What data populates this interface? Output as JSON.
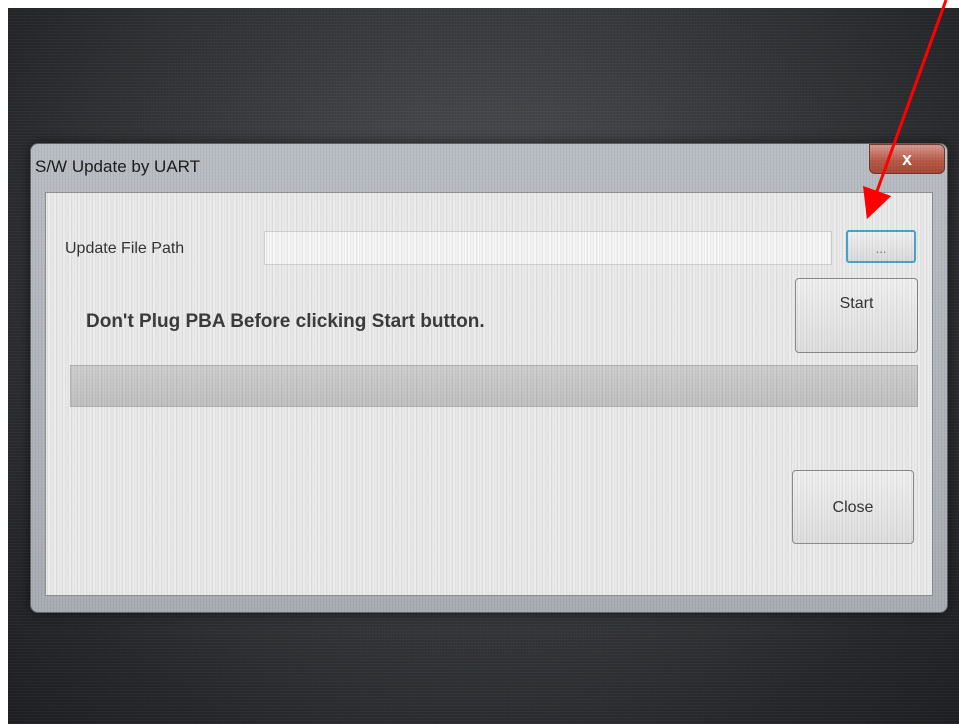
{
  "window": {
    "title": "S/W Update by UART",
    "close_glyph": "x"
  },
  "update_file_path": {
    "label": "Update File Path",
    "value": "",
    "browse_label": "..."
  },
  "warning": "Don't Plug PBA Before clicking Start button.",
  "buttons": {
    "start": "Start",
    "close": "Close"
  },
  "progress": {
    "fraction": 0
  },
  "colors": {
    "annotation_arrow": "#ff0000",
    "focus_border": "#4aa3c9",
    "close_button_red": "#b85a48"
  },
  "icons": [
    "close-icon",
    "mouse-cursor-icon",
    "annotation-arrow"
  ]
}
